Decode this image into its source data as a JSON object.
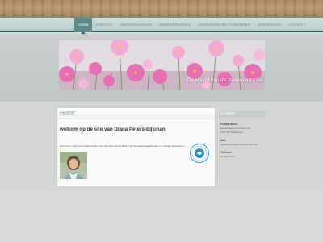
{
  "nav": {
    "items": [
      {
        "label": "HOME",
        "active": true
      },
      {
        "label": "CONTACT",
        "active": false
      },
      {
        "label": "BEHANDELINGEN",
        "active": false
      },
      {
        "label": "ONDERSTEUNING",
        "active": false
      },
      {
        "label": "CURSUSSEN EN TRAININGEN",
        "active": false
      },
      {
        "label": "ERVARINGEN",
        "active": false
      },
      {
        "label": "CONTACT",
        "active": false
      }
    ]
  },
  "hero": {
    "title": "De kracht van de zuivere intentie",
    "colors": {
      "bloom": "#e46fb5",
      "bloom_light": "#f6b8de",
      "stem": "#6f8f5a"
    }
  },
  "content": {
    "heading": "Home",
    "welcome": "welkom op de site van Diana Peters-Eijkman",
    "intro": "Hier kunt u meer informatie vinden over het werk als Medium, mijn therapiemogelijkheden en overige activiteiten.",
    "portrait_icon": "portrait-photo",
    "badge_icon": "certification-badge"
  },
  "sidebar": {
    "heading": "Contact",
    "practice_label": "Praktijk adres:",
    "address_line1": "Kastanhage Grotestrag 231",
    "address_line2": "1234 AB Plaatsnaam",
    "email_label": "Mail:",
    "email": "dianapeters-eijkman@hotmail.com",
    "phone_label": "Telefoon:",
    "phone": "06 45487895"
  },
  "colors": {
    "accent": "#2a5d62",
    "nav_active": "#5b8a89",
    "heading_teal": "#6fa0a0"
  }
}
